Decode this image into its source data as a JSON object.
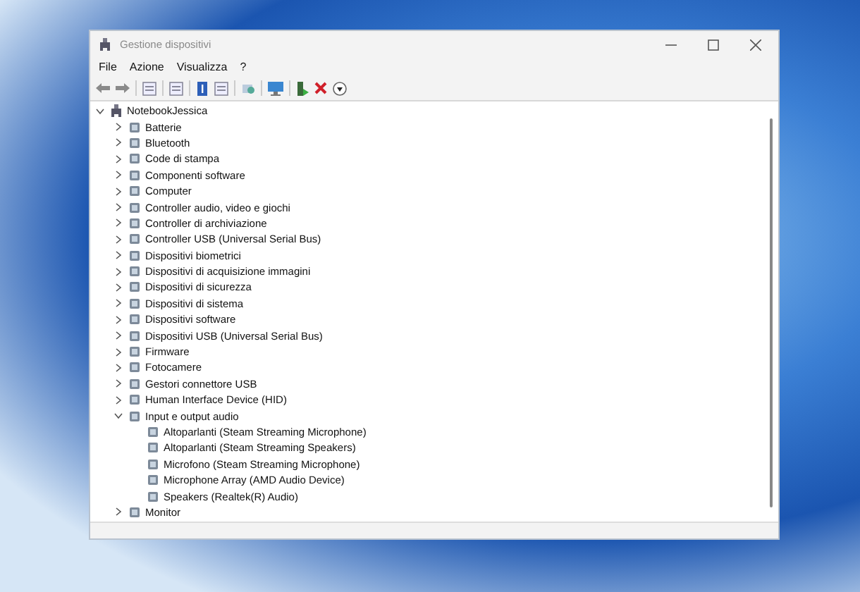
{
  "window": {
    "title": "Gestione dispositivi"
  },
  "menu": [
    "File",
    "Azione",
    "Visualizza",
    "?"
  ],
  "tree": {
    "label": "NotebookJessica",
    "expanded": true,
    "children": [
      {
        "label": "Batterie",
        "expanded": false
      },
      {
        "label": "Bluetooth",
        "expanded": false
      },
      {
        "label": "Code di stampa",
        "expanded": false
      },
      {
        "label": "Componenti software",
        "expanded": false
      },
      {
        "label": "Computer",
        "expanded": false
      },
      {
        "label": "Controller audio, video e giochi",
        "expanded": false
      },
      {
        "label": "Controller di archiviazione",
        "expanded": false
      },
      {
        "label": "Controller USB (Universal Serial Bus)",
        "expanded": false
      },
      {
        "label": "Dispositivi biometrici",
        "expanded": false
      },
      {
        "label": "Dispositivi di acquisizione immagini",
        "expanded": false
      },
      {
        "label": "Dispositivi di sicurezza",
        "expanded": false
      },
      {
        "label": "Dispositivi di sistema",
        "expanded": false
      },
      {
        "label": "Dispositivi software",
        "expanded": false
      },
      {
        "label": "Dispositivi USB (Universal Serial Bus)",
        "expanded": false
      },
      {
        "label": "Firmware",
        "expanded": false
      },
      {
        "label": "Fotocamere",
        "expanded": false
      },
      {
        "label": "Gestori connettore USB",
        "expanded": false
      },
      {
        "label": "Human Interface Device (HID)",
        "expanded": false
      },
      {
        "label": "Input e output audio",
        "expanded": true,
        "children": [
          {
            "label": "Altoparlanti (Steam Streaming Microphone)"
          },
          {
            "label": "Altoparlanti (Steam Streaming Speakers)"
          },
          {
            "label": "Microfono (Steam Streaming Microphone)"
          },
          {
            "label": "Microphone Array (AMD Audio Device)"
          },
          {
            "label": "Speakers (Realtek(R) Audio)"
          }
        ]
      },
      {
        "label": "Monitor",
        "expanded": false
      }
    ]
  }
}
